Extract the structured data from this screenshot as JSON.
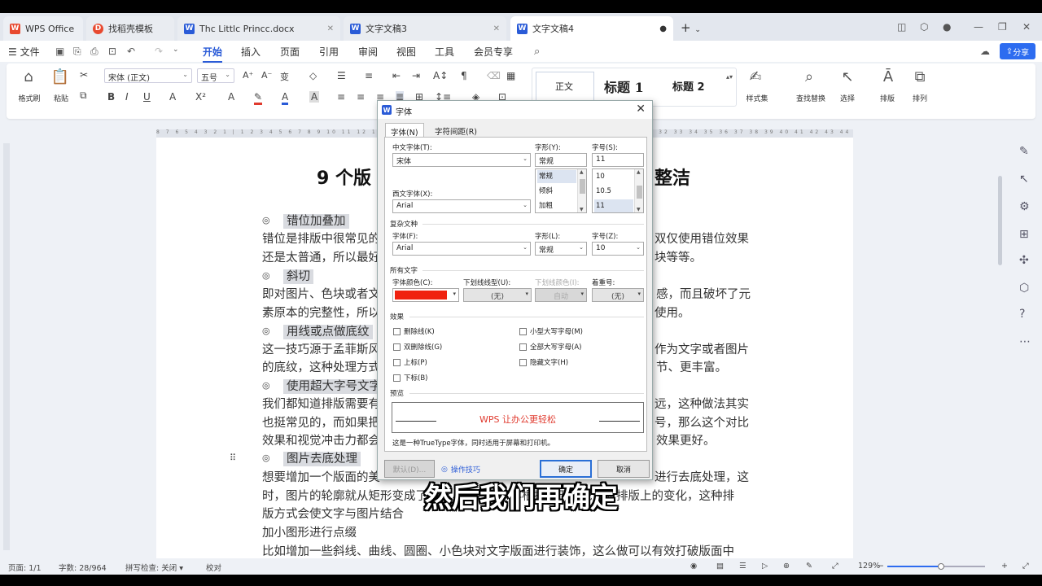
{
  "tabs": [
    {
      "label": "WPS Office",
      "icon": "wps-logo-icon",
      "color": "#e8492f"
    },
    {
      "label": "找稻壳模板",
      "icon": "docer-icon",
      "color": "#e8492f"
    },
    {
      "label": "Thc Littlc Princc.docx",
      "icon": "word-doc-icon",
      "color": "#2a5bd7"
    },
    {
      "label": "文字文稿3",
      "icon": "word-doc-icon",
      "color": "#2a5bd7"
    },
    {
      "label": "文字文稿4",
      "icon": "word-doc-icon",
      "color": "#2a5bd7"
    }
  ],
  "menu": {
    "file": "文件",
    "items": [
      "开始",
      "插入",
      "页面",
      "引用",
      "审阅",
      "视图",
      "工具",
      "会员专享"
    ],
    "active": "开始",
    "share": "分享"
  },
  "ribbon": {
    "format_painter": "格式刷",
    "paste": "粘贴",
    "font_name": "宋体 (正文)",
    "font_size": "五号",
    "style_normal": "正文",
    "style_h1": "标题 1",
    "style_h2": "标题 2",
    "style_set": "样式集",
    "find_replace": "查找替换",
    "select": "选择",
    "layout": "排版",
    "arrange": "排列"
  },
  "ruler_text": "8 7 6 5 4 3 2 1 | 1 2 3 4 5 6 7 8 9 10 11 12 13 14 15 16 17 18 19 20 21 22 23 24 25 26 27 28 29 30 31 32 33 34 35 36 37 38 39 40 41 42 43 44 45 46 47",
  "document": {
    "title_left": "9 个版",
    "title_right": "整洁",
    "headings": [
      "错位加叠加",
      "斜切",
      "用线或点做底纹",
      "使用超大字号文字",
      "图片去底处理"
    ],
    "lines": [
      {
        "left": "错位是排版中很常见的",
        "right": "双仅使用错位效果"
      },
      {
        "left": "还是太普通，所以最好",
        "right": "块等等。"
      },
      {
        "left": "即对图片、色块或者文",
        "right": "感，而且破坏了元"
      },
      {
        "left": "素原本的完整性，所以",
        "right": "使用。"
      },
      {
        "left": "这一技巧源于孟菲斯风",
        "right": "作为文字或者图片"
      },
      {
        "left": "的底纹，这种处理方式",
        "right": "节、更丰富。"
      },
      {
        "left": "我们都知道排版需要有",
        "right": "远，这种做法其实"
      },
      {
        "left": "也挺常见的，而如果把",
        "right": "号，那么这个对比"
      },
      {
        "left": "效果和视觉冲击力都会",
        "right": "效果更好。"
      },
      {
        "left": "想要增加一个版面的美",
        "right": "进行去底处理，这"
      },
      {
        "left": "时，图片的轮廓就从矩形变成了异形，然后文字再根据图形的轮廓做排版上的变化，这种排",
        "right": ""
      },
      {
        "left": "版方式会使文字与图片结合",
        "right": ""
      },
      {
        "left": "加小图形进行点缀",
        "right": ""
      },
      {
        "left": "比如增加一些斜线、曲线、圆圈、小色块对文字版面进行装饰，这么做可以有效打破版面中",
        "right": ""
      }
    ]
  },
  "dialog": {
    "title": "字体",
    "tabs": [
      "字体(N)",
      "字符间距(R)"
    ],
    "chinese_font_label": "中文字体(T):",
    "chinese_font_value": "宋体",
    "style_label": "字形(Y):",
    "style_value": "常规",
    "size_label": "字号(S):",
    "size_value": "11",
    "style_options": [
      "常规",
      "倾斜",
      "加粗"
    ],
    "size_options": [
      "10",
      "10.5",
      "11"
    ],
    "western_font_label": "西文字体(X):",
    "western_font_value": "Arial",
    "complex_section": "复杂文种",
    "complex_font_label": "字体(F):",
    "complex_font_value": "Arial",
    "complex_style_label": "字形(L):",
    "complex_style_value": "常规",
    "complex_size_label": "字号(Z):",
    "complex_size_value": "10",
    "all_text_section": "所有文字",
    "font_color_label": "字体颜色(C):",
    "font_color": "#f0210f",
    "underline_label": "下划线线型(U):",
    "underline_value": "(无)",
    "underline_color_label": "下划线颜色(I):",
    "underline_color_value": "自动",
    "emphasis_label": "着重号:",
    "emphasis_value": "(无)",
    "effects_section": "效果",
    "effects_left": [
      "删除线(K)",
      "双删除线(G)",
      "上标(P)",
      "下标(B)"
    ],
    "effects_right": [
      "小型大写字母(M)",
      "全部大写字母(A)",
      "隐藏文字(H)"
    ],
    "preview_section": "预览",
    "preview_text": "WPS 让办公更轻松",
    "truetype_note": "这是一种TrueType字体，同时适用于屏幕和打印机。",
    "default_button": "默认(D)...",
    "tips_link": "操作技巧",
    "ok_button": "确定",
    "cancel_button": "取消"
  },
  "status": {
    "page": "页面: 1/1",
    "words": "字数: 28/964",
    "spell": "拼写检查: 关闭 ▾",
    "proof": "校对",
    "zoom": "129%",
    "zoom_fraction": 0.55
  },
  "subtitle": "然后我们再确定"
}
